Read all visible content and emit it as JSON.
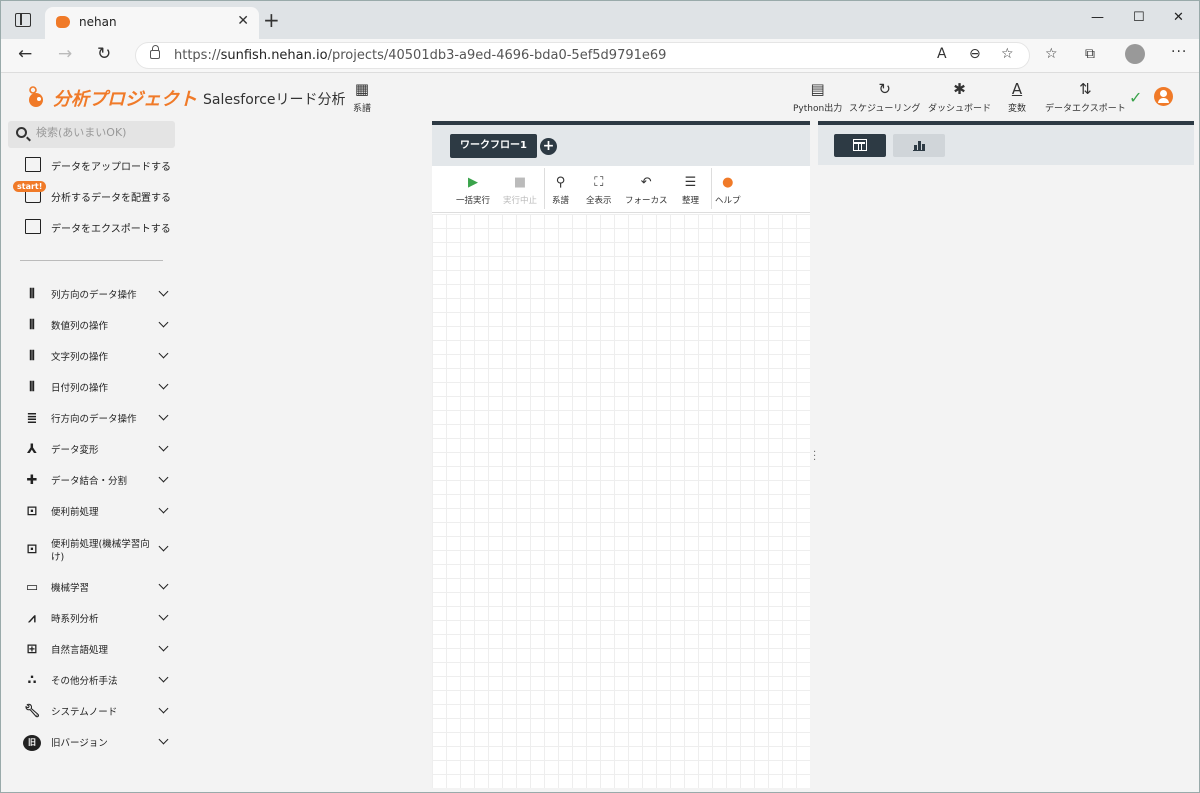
{
  "browser": {
    "tab_title": "nehan",
    "url_domain": "sunfish.nehan.io",
    "url_path": "/projects/40501db3-a9ed-4696-bda0-5ef5d9791e69",
    "url_scheme": "https://"
  },
  "header": {
    "logo_text": "分析プロジェクト",
    "project_name": "Salesforceリード分析",
    "keifu_label": "系譜",
    "buttons": [
      {
        "icon": "file-icon",
        "label": "Python出力"
      },
      {
        "icon": "schedule-icon",
        "label": "スケジューリング"
      },
      {
        "icon": "dashboard-icon",
        "label": "ダッシュボード"
      },
      {
        "icon": "variable-icon",
        "label": "変数"
      },
      {
        "icon": "export-icon",
        "label": "データエクスポート"
      }
    ]
  },
  "sidebar": {
    "search_placeholder": "検索(あいまいOK)",
    "actions": [
      {
        "label": "データをアップロードする",
        "icon": "upload-icon"
      },
      {
        "label": "分析するデータを配置する",
        "icon": "place-data-icon"
      },
      {
        "label": "データをエクスポートする",
        "icon": "export-down-icon"
      }
    ],
    "start_badge": "start!",
    "categories": [
      {
        "label": "列方向のデータ操作",
        "icon": "columns-icon"
      },
      {
        "label": "数値列の操作",
        "icon": "columns-icon"
      },
      {
        "label": "文字列の操作",
        "icon": "columns-icon"
      },
      {
        "label": "日付列の操作",
        "icon": "columns-icon"
      },
      {
        "label": "行方向のデータ操作",
        "icon": "rows-icon"
      },
      {
        "label": "データ変形",
        "icon": "transform-icon"
      },
      {
        "label": "データ結合・分割",
        "icon": "puzzle-icon"
      },
      {
        "label": "便利前処理",
        "icon": "preprocess-icon"
      },
      {
        "label": "便利前処理(機械学習向け)",
        "icon": "preprocess-icon"
      },
      {
        "label": "機械学習",
        "icon": "ml-icon"
      },
      {
        "label": "時系列分析",
        "icon": "timeseries-icon"
      },
      {
        "label": "自然言語処理",
        "icon": "nlp-icon"
      },
      {
        "label": "その他分析手法",
        "icon": "other-icon"
      },
      {
        "label": "システムノード",
        "icon": "wrench-icon"
      },
      {
        "label": "旧バージョン",
        "icon": "old-version-icon"
      }
    ]
  },
  "workflow": {
    "tab_label": "ワークフロー1",
    "add_label": "+",
    "tools": [
      {
        "label": "一括実行",
        "icon": "play-icon"
      },
      {
        "label": "実行中止",
        "icon": "stop-icon"
      },
      {
        "label": "系譜",
        "icon": "lineage-icon"
      },
      {
        "label": "全表示",
        "icon": "fit-icon"
      },
      {
        "label": "フォーカス",
        "icon": "focus-icon"
      },
      {
        "label": "整理",
        "icon": "arrange-icon"
      },
      {
        "label": "ヘルプ",
        "icon": "help-icon"
      }
    ]
  },
  "colors": {
    "brand_orange": "#f07a28",
    "panel_dark": "#2d3a44",
    "run_green": "#3aa34b"
  }
}
